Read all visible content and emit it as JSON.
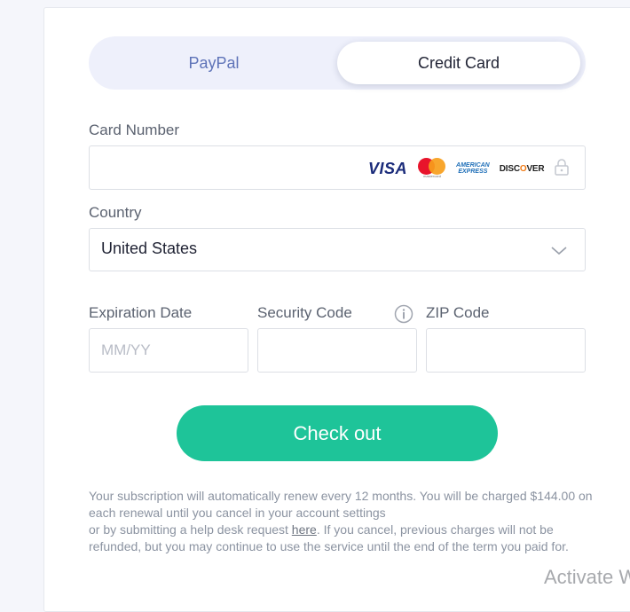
{
  "tabs": {
    "paypal": "PayPal",
    "credit_card": "Credit Card",
    "active": "Credit Card"
  },
  "card_number": {
    "label": "Card Number",
    "value": "",
    "brands": {
      "visa": "VISA",
      "mastercard": "mastercard",
      "amex_line1": "AMERICAN",
      "amex_line2": "EXPRESS",
      "discover_a": "DISC",
      "discover_o": "O",
      "discover_b": "VER"
    }
  },
  "country": {
    "label": "Country",
    "selected": "United States"
  },
  "expiration": {
    "label": "Expiration Date",
    "placeholder": "MM/YY",
    "value": ""
  },
  "security_code": {
    "label": "Security Code",
    "value": ""
  },
  "zip": {
    "label": "ZIP Code",
    "value": ""
  },
  "checkout_button": "Check out",
  "notice": {
    "part1": "Your subscription will automatically renew every 12 months. You will be charged $144.00 on each renewal until you cancel in your account settings",
    "part2": "or by submitting a help desk request ",
    "link": "here",
    "part3": ". If you cancel, previous charges will not be refunded, but you may continue to use the service until the end of the term you paid for."
  },
  "watermark": "Activate Windows",
  "colors": {
    "accent": "#1ec499",
    "paypal_tab_text": "#5e73b8",
    "tab_bg": "#eef0fb"
  },
  "icons": [
    "lock-icon",
    "chevron-down-icon",
    "info-icon"
  ]
}
